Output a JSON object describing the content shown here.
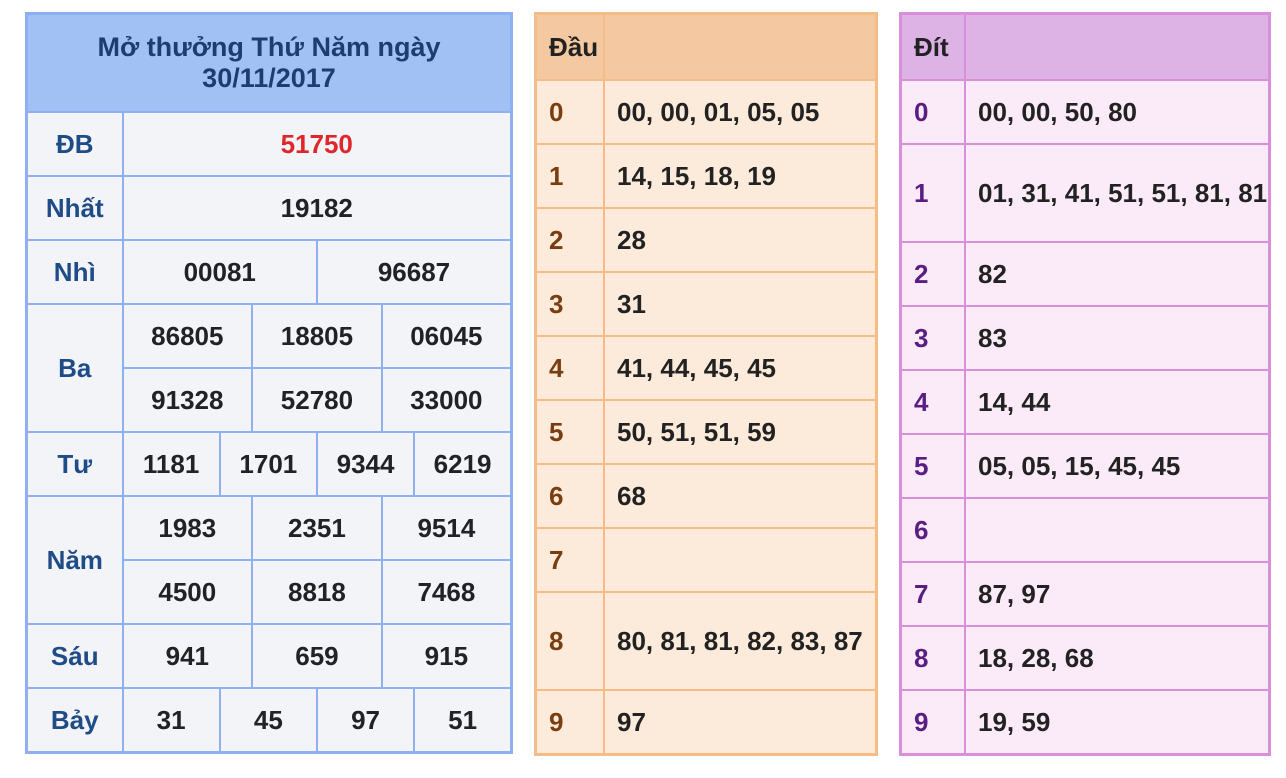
{
  "results": {
    "title_line1": "Mở thưởng Thứ Năm ngày",
    "title_line2": "30/11/2017",
    "db": {
      "label": "ĐB",
      "value": "51750"
    },
    "nhat": {
      "label": "Nhất",
      "value": "19182"
    },
    "nhi": {
      "label": "Nhì",
      "values": [
        "00081",
        "96687"
      ]
    },
    "ba": {
      "label": "Ba",
      "values": [
        "86805",
        "18805",
        "06045",
        "91328",
        "52780",
        "33000"
      ]
    },
    "tu": {
      "label": "Tư",
      "values": [
        "1181",
        "1701",
        "9344",
        "6219"
      ]
    },
    "nam": {
      "label": "Năm",
      "values": [
        "1983",
        "2351",
        "9514",
        "4500",
        "8818",
        "7468"
      ]
    },
    "sau": {
      "label": "Sáu",
      "values": [
        "941",
        "659",
        "915"
      ]
    },
    "bay": {
      "label": "Bảy",
      "values": [
        "31",
        "45",
        "97",
        "51"
      ]
    }
  },
  "heads": {
    "header": "Đầu",
    "rows": [
      {
        "key": "0",
        "value": "00, 00, 01, 05, 05"
      },
      {
        "key": "1",
        "value": "14, 15, 18, 19"
      },
      {
        "key": "2",
        "value": "28"
      },
      {
        "key": "3",
        "value": "31"
      },
      {
        "key": "4",
        "value": "41, 44, 45, 45"
      },
      {
        "key": "5",
        "value": "50, 51, 51, 59"
      },
      {
        "key": "6",
        "value": "68"
      },
      {
        "key": "7",
        "value": ""
      },
      {
        "key": "8",
        "value": "80, 81, 81, 82, 83, 87"
      },
      {
        "key": "9",
        "value": "97"
      }
    ]
  },
  "tails": {
    "header": "Đít",
    "rows": [
      {
        "key": "0",
        "value": "00, 00, 50, 80"
      },
      {
        "key": "1",
        "value": "01, 31, 41, 51, 51, 81, 81"
      },
      {
        "key": "2",
        "value": "82"
      },
      {
        "key": "3",
        "value": "83"
      },
      {
        "key": "4",
        "value": "14, 44"
      },
      {
        "key": "5",
        "value": "05, 05, 15, 45, 45"
      },
      {
        "key": "6",
        "value": ""
      },
      {
        "key": "7",
        "value": "87, 97"
      },
      {
        "key": "8",
        "value": "18, 28, 68"
      },
      {
        "key": "9",
        "value": "19, 59"
      }
    ]
  },
  "colors": {
    "results_border": "#8fb0f0",
    "heads_border": "#f4bd88",
    "tails_border": "#d98fd9",
    "special_prize": "#e0262a"
  }
}
